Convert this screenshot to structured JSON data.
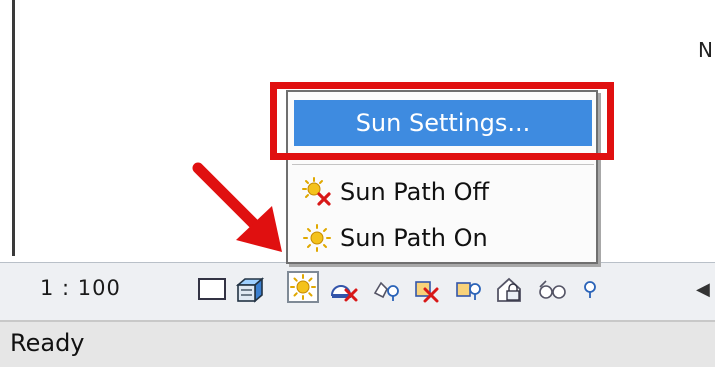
{
  "canvas": {
    "north_label": "N"
  },
  "view_bar": {
    "scale": "1 : 100",
    "icons": [
      "detail-level-icon",
      "visual-style-icon",
      "sun-path-icon",
      "shadows-off-icon",
      "show-rendering-dialog-icon",
      "crop-view-icon",
      "show-crop-region-icon",
      "temporary-hide-icon",
      "reveal-hidden-icon",
      "temporary-view-properties-icon"
    ]
  },
  "menu": {
    "settings_label": "Sun Settings...",
    "off_label": "Sun Path Off",
    "on_label": "Sun Path On"
  },
  "status": {
    "text": "Ready"
  },
  "colors": {
    "highlight": "#e01010",
    "menu_selection": "#3e8be0",
    "sun": "#f4c21c"
  }
}
